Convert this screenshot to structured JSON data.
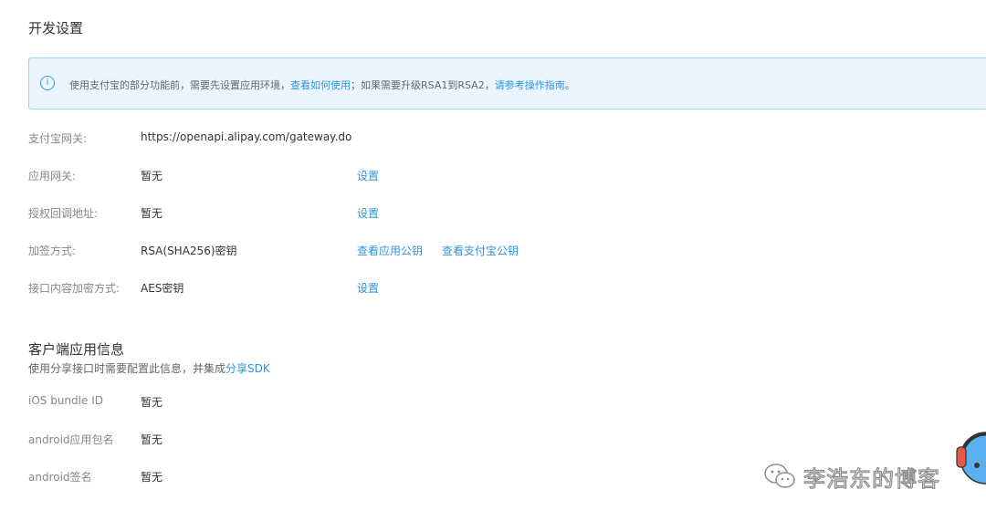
{
  "dev_settings": {
    "title": "开发设置",
    "notice": {
      "text_before": "使用支付宝的部分功能前，需要先设置应用环境，",
      "link1": "查看如何使用",
      "text_middle": "；如果需要升级RSA1到RSA2，",
      "link2": "请参考操作指南",
      "text_after": "。"
    },
    "rows": [
      {
        "label": "支付宝网关:",
        "value": "https://openapi.alipay.com/gateway.do"
      },
      {
        "label": "应用网关:",
        "value": "暂无",
        "action": "设置"
      },
      {
        "label": "授权回调地址:",
        "value": "暂无",
        "action": "设置"
      },
      {
        "label": "加签方式:",
        "value": "RSA(SHA256)密钥",
        "action": "查看应用公钥",
        "action2": "查看支付宝公钥"
      },
      {
        "label": "接口内容加密方式:",
        "value": "AES密钥",
        "action": "设置"
      }
    ]
  },
  "client_info": {
    "title": "客户端应用信息",
    "subtitle": "使用分享接口时需要配置此信息，并集成",
    "subtitle_link": "分享SDK",
    "rows": [
      {
        "label": "iOS bundle ID",
        "value": "暂无"
      },
      {
        "label": "android应用包名",
        "value": "暂无"
      },
      {
        "label": "android签名",
        "value": "暂无"
      }
    ]
  },
  "watermark": {
    "text": "李浩东的博客",
    "icon": "wechat-icon"
  },
  "colors": {
    "link": "#2f95dc",
    "notice_bg": "#eaf5fd",
    "notice_border": "#9fd2f3"
  }
}
